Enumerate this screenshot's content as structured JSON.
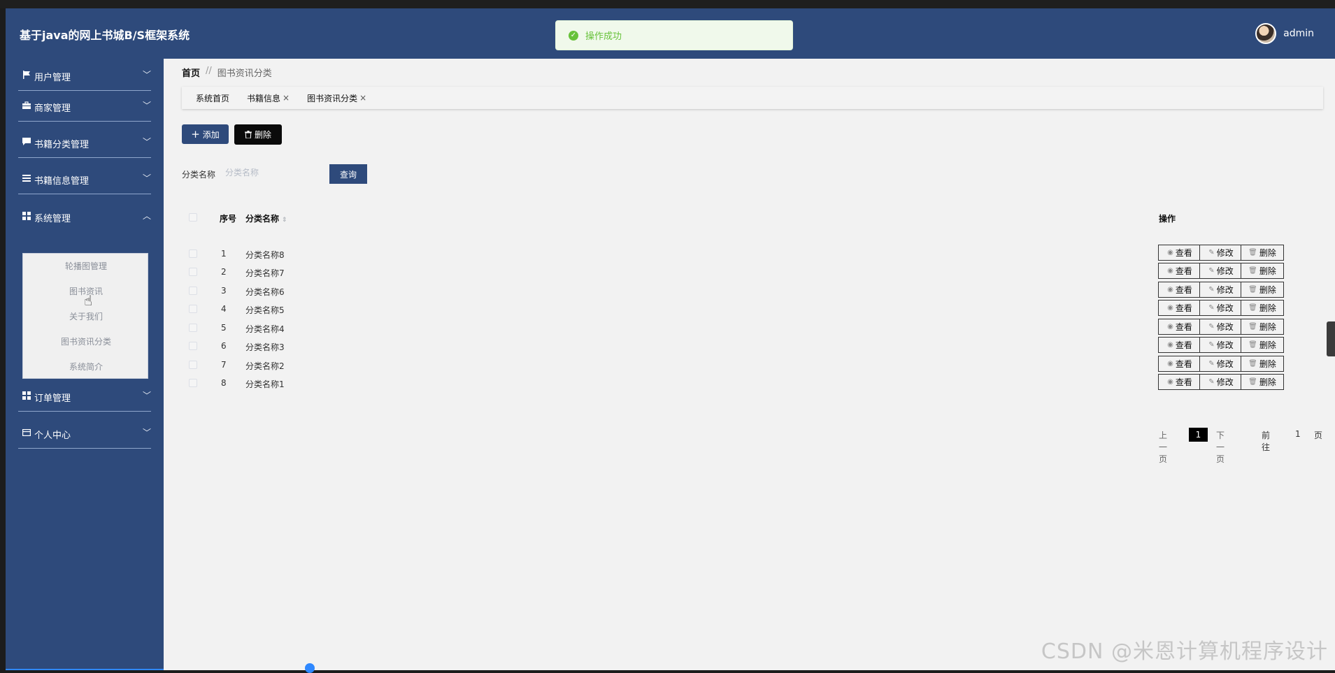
{
  "app": {
    "title": "基于java的网上书城B/S框架系统"
  },
  "user": {
    "name": "admin"
  },
  "toast": {
    "text": "操作成功",
    "icon": "check-circle-icon"
  },
  "sidebar": {
    "items": [
      {
        "label": "用户管理",
        "icon": "flag-icon"
      },
      {
        "label": "商家管理",
        "icon": "briefcase-icon"
      },
      {
        "label": "书籍分类管理",
        "icon": "comment-icon"
      },
      {
        "label": "书籍信息管理",
        "icon": "list-icon"
      },
      {
        "label": "系统管理",
        "icon": "grid-icon"
      },
      {
        "label": "订单管理",
        "icon": "grid-icon"
      },
      {
        "label": "个人中心",
        "icon": "card-icon"
      }
    ],
    "submenu": [
      "轮播图管理",
      "图书资讯",
      "关于我们",
      "图书资讯分类",
      "系统简介"
    ]
  },
  "breadcrumb": {
    "home": "首页",
    "separator": "//",
    "current": "图书资讯分类"
  },
  "tabs": [
    "系统首页",
    "书籍信息",
    "图书资讯分类"
  ],
  "toolbar": {
    "add_label": "添加",
    "delete_label": "删除"
  },
  "filter": {
    "label": "分类名称",
    "placeholder": "分类名称",
    "query_label": "查询"
  },
  "table": {
    "headers": {
      "no": "序号",
      "name": "分类名称",
      "op": "操作"
    },
    "rows": [
      {
        "no": "1",
        "name": "分类名称8"
      },
      {
        "no": "2",
        "name": "分类名称7"
      },
      {
        "no": "3",
        "name": "分类名称6"
      },
      {
        "no": "4",
        "name": "分类名称5"
      },
      {
        "no": "5",
        "name": "分类名称4"
      },
      {
        "no": "6",
        "name": "分类名称3"
      },
      {
        "no": "7",
        "name": "分类名称2"
      },
      {
        "no": "8",
        "name": "分类名称1"
      }
    ],
    "actions": {
      "view": "查看",
      "edit": "修改",
      "delete": "删除"
    }
  },
  "pagination": {
    "prev": "上一页",
    "current": "1",
    "next": "下一页",
    "goto": "前往",
    "goto_value": "1",
    "page_suffix": "页"
  },
  "watermark": "CSDN @米恩计算机程序设计",
  "colors": {
    "primary": "#2e4a7b",
    "success": "#67c23a",
    "content_bg": "#f2f2f2"
  }
}
